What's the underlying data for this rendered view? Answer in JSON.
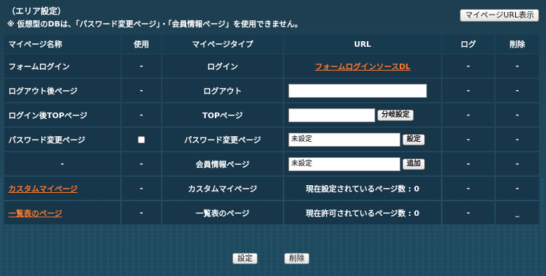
{
  "header": {
    "area_title": "（エリア設定）",
    "notice": "※ 仮想型のDBは、「パスワード変更ページ」・「会員情報ページ」を使用できません。",
    "url_display_button": "マイページURL表示"
  },
  "table": {
    "headers": [
      "マイページ名称",
      "使用",
      "マイページタイプ",
      "URL",
      "ログ",
      "削除"
    ],
    "rows": [
      {
        "name": "フォームログイン",
        "use": "-",
        "type": "ログイン",
        "url_link": "フォームログインソースDL",
        "log": "-",
        "del": "-"
      },
      {
        "name": "ログアウト後ページ",
        "use": "-",
        "type": "ログアウト",
        "url_value": "",
        "log": "-",
        "del": "-"
      },
      {
        "name": "ログイン後TOPページ",
        "use": "-",
        "type": "TOPページ",
        "url_value": "",
        "button": "分岐設定",
        "log": "-",
        "del": "-"
      },
      {
        "name": "パスワード変更ページ",
        "use_checked": false,
        "type": "パスワード変更ページ",
        "url_value": "未設定",
        "button": "設定",
        "log": "-",
        "del": "-"
      },
      {
        "name": "-",
        "use": "-",
        "type": "会員情報ページ",
        "url_value": "未設定",
        "button": "追加",
        "log": "-",
        "del": "-"
      },
      {
        "name_link": "カスタムマイページ",
        "use": "-",
        "type": "カスタムマイページ",
        "url_text": "現在設定されているページ数 : 0",
        "log": "-",
        "del": "-"
      },
      {
        "name_link": "一覧表のページ",
        "use": "-",
        "type": "一覧表のページ",
        "url_text": "現在許可されているページ数 : 0",
        "log": "-",
        "del": "_"
      }
    ]
  },
  "footer": {
    "save_button": "設定",
    "delete_button": "削除"
  }
}
